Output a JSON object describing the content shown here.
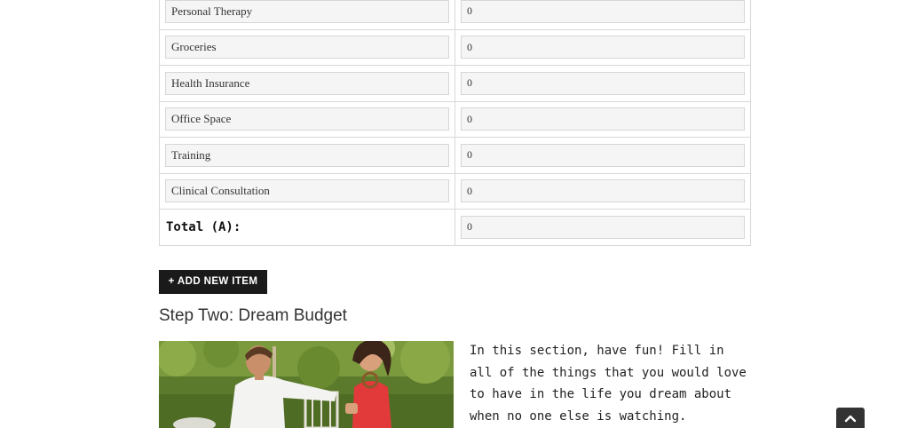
{
  "budget_table": {
    "rows": [
      {
        "label": "Personal Therapy",
        "value": "0"
      },
      {
        "label": "Groceries",
        "value": "0"
      },
      {
        "label": "Health Insurance",
        "value": "0"
      },
      {
        "label": "Office Space",
        "value": "0"
      },
      {
        "label": "Training",
        "value": "0"
      },
      {
        "label": "Clinical Consultation",
        "value": "0"
      }
    ],
    "total": {
      "label": "Total (A):",
      "value": "0"
    }
  },
  "actions": {
    "add_item_label": "+ ADD NEW ITEM"
  },
  "step_two": {
    "title": "Step Two: Dream Budget",
    "intro": "In this section, have fun! Fill in all of the things that you would love to have in the life you dream about when no one else is watching."
  },
  "icons": {
    "scroll_top": "chevron-up-icon"
  },
  "colors": {
    "button_bg": "#1a1a1a",
    "input_bg": "#f5f5f5",
    "border": "#d8d8d8"
  }
}
